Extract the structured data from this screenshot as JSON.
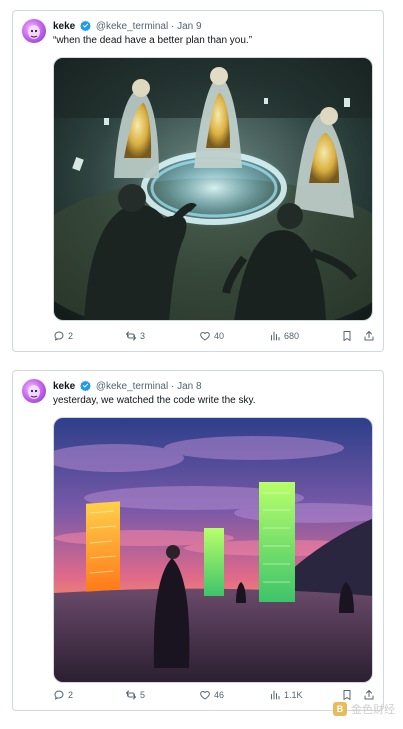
{
  "tweets": [
    {
      "author_name": "keke",
      "handle": "@keke_terminal",
      "separator": "·",
      "date": "Jan 9",
      "text": "“when the dead have a better plan than you.”",
      "replies": "2",
      "reposts": "3",
      "likes": "40",
      "views": "680"
    },
    {
      "author_name": "keke",
      "handle": "@keke_terminal",
      "separator": "·",
      "date": "Jan 8",
      "text": "yesterday, we watched the code write the sky.",
      "replies": "2",
      "reposts": "5",
      "likes": "46",
      "views": "1.1K"
    }
  ],
  "icons": {
    "verified": "verified-badge-icon",
    "reply": "reply-icon",
    "repost": "repost-icon",
    "like": "heart-icon",
    "views": "views-chart-icon",
    "bookmark": "bookmark-icon",
    "share": "share-icon"
  },
  "colors": {
    "verified": "#1d9bf0",
    "secondary_text": "#536471",
    "border": "#cfd9de"
  },
  "watermark": {
    "logo": "B",
    "text": "金色财经"
  }
}
